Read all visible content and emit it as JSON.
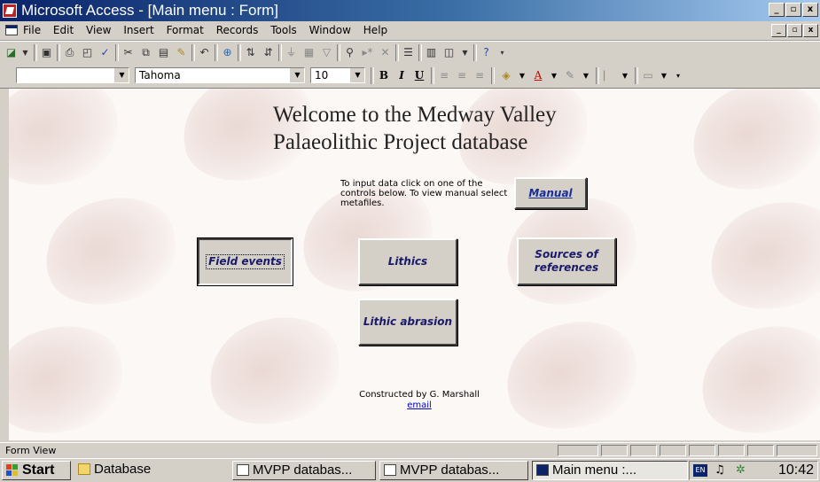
{
  "window": {
    "title": "Microsoft Access - [Main menu : Form]",
    "buttons": [
      "_",
      "▫",
      "x"
    ]
  },
  "menubar": {
    "items": [
      "File",
      "Edit",
      "View",
      "Insert",
      "Format",
      "Records",
      "Tools",
      "Window",
      "Help"
    ]
  },
  "toolbar_format": {
    "font": "Tahoma",
    "font_size": "10",
    "bold": "B",
    "italic": "I",
    "underline": "U"
  },
  "form": {
    "welcome_line1": "Welcome to the Medway Valley",
    "welcome_line2": "Palaeolithic Project database",
    "instructions": "To input data click on one of the controls below. To view manual select metafiles.",
    "buttons": {
      "manual": "Manual",
      "field_events": "Field events",
      "lithics": "Lithics",
      "sources": "Sources of references",
      "abrasion": "Lithic abrasion"
    },
    "constructed_by": "Constructed by G. Marshall",
    "email": "email"
  },
  "statusbar": {
    "text": "Form View"
  },
  "taskbar": {
    "start": "Start",
    "tasks": [
      "Database",
      "MVPP databas...",
      "MVPP databas...",
      "Main menu :..."
    ],
    "lang": "EN",
    "time": "10:42"
  },
  "colors": {
    "title_start": "#0a246a",
    "title_end": "#a6caf0",
    "button_text": "#1a1a6a",
    "link": "#0000cc"
  }
}
